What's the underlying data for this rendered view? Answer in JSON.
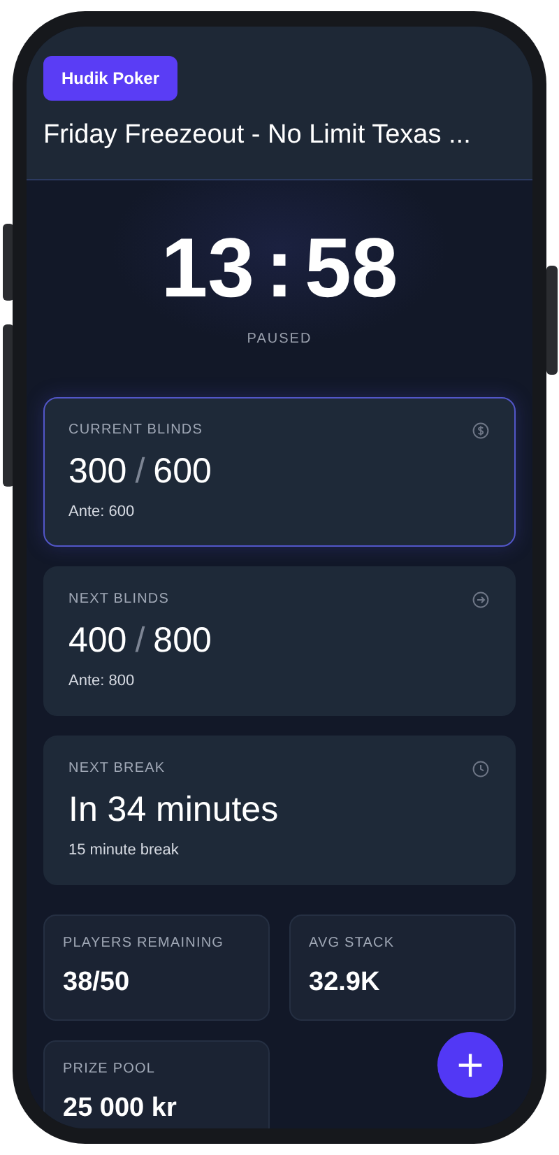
{
  "header": {
    "badge": "Hudik Poker",
    "title": "Friday Freezeout - No Limit Texas ..."
  },
  "timer": {
    "minutes": "13",
    "separator": ":",
    "seconds": "58",
    "status": "PAUSED"
  },
  "cards": [
    {
      "kind": "blinds",
      "label": "CURRENT BLINDS",
      "small": "300",
      "separator": "/",
      "big": "600",
      "note": "Ante: 600",
      "highlighted": true
    },
    {
      "kind": "upcoming",
      "label": "NEXT BLINDS",
      "small": "400",
      "separator": "/",
      "big": "800",
      "note": "Ante: 800",
      "highlighted": false
    },
    {
      "kind": "break",
      "label": "NEXT BREAK",
      "value": "In 34 minutes",
      "note": "15 minute break",
      "highlighted": false
    }
  ],
  "stats": [
    {
      "label": "PLAYERS REMAINING",
      "value": "38/50"
    },
    {
      "label": "AVG STACK",
      "value": "32.9K"
    },
    {
      "label": "PRIZE POOL",
      "value": "25 000 kr"
    }
  ],
  "fab": {
    "symbol": "+"
  }
}
